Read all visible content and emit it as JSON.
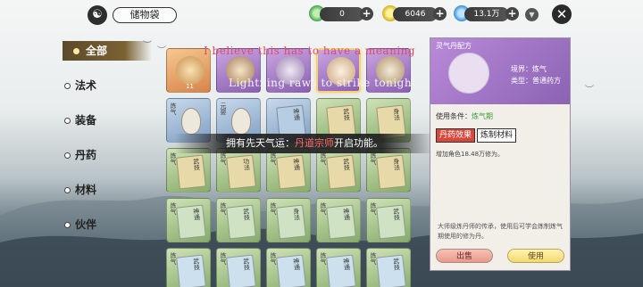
{
  "topbar": {
    "logo_icon": "ink-face-icon",
    "title": "储物袋",
    "resources": [
      {
        "icon": "jade-ring-icon",
        "value": "0",
        "color": "#3fa34d"
      },
      {
        "icon": "gold-coin-icon",
        "value": "6046",
        "color": "#d4b21c"
      },
      {
        "icon": "spirit-gem-icon",
        "value": "13.1万",
        "color": "#3a8fd1"
      }
    ]
  },
  "sidebar": {
    "items": [
      {
        "label": "全部",
        "active": true
      },
      {
        "label": "法术",
        "active": false
      },
      {
        "label": "装备",
        "active": false
      },
      {
        "label": "丹药",
        "active": false
      },
      {
        "label": "材料",
        "active": false
      },
      {
        "label": "伙伴",
        "active": false
      }
    ]
  },
  "overlay": {
    "red_caption": "I believe this has to have a meaning",
    "white_caption": "Lightning raws to strike tonight",
    "banner_prefix": "拥有先天气运：",
    "banner_highlight": "丹道宗师",
    "banner_suffix": "开启功能。"
  },
  "grid": {
    "first_count": "11",
    "gourd_tags": [
      "炼气",
      "元婴"
    ],
    "book_tags": [
      "炼气",
      "神通",
      "武技",
      "身法",
      "功法"
    ]
  },
  "detail": {
    "title": "灵气丹配方",
    "realm_label": "境界：",
    "realm_value": "炼气",
    "type_label": "类型：",
    "type_value": "普通药方",
    "condition_label": "使用条件：",
    "condition_value": "炼气期",
    "tab_effect": "丹药效果",
    "tab_material": "炼制材料",
    "effect_text": "增加角色18.48万修为。",
    "description": "大师级炼丹师的传承，使用后可学会炼制炼气期使用的修为丹。",
    "sell_label": "出售",
    "use_label": "使用"
  }
}
